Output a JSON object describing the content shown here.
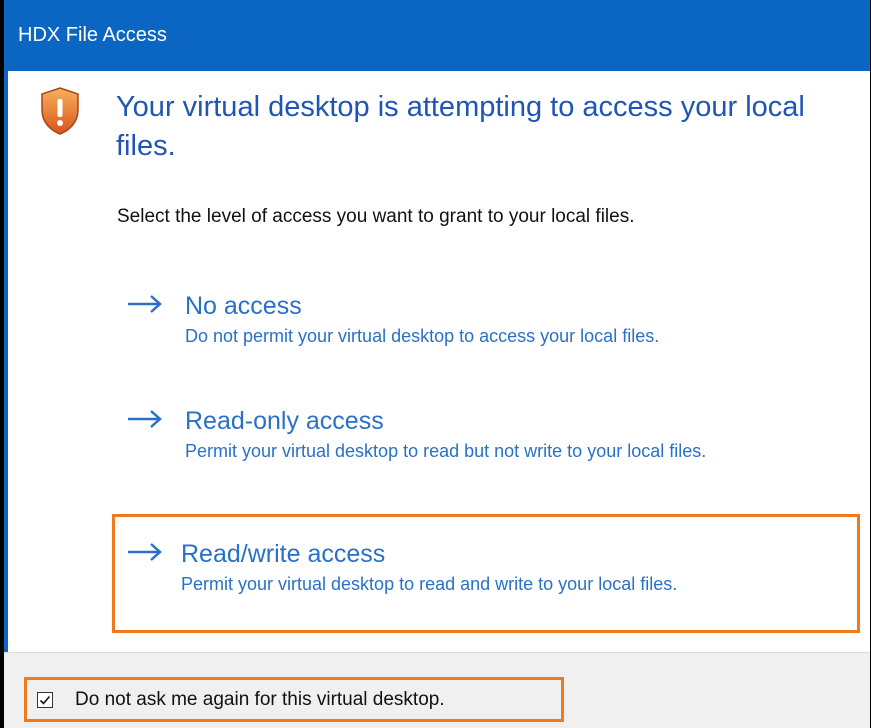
{
  "window": {
    "title": "HDX File Access"
  },
  "prompt": {
    "heading": "Your virtual desktop is attempting to access your local files.",
    "subtitle": "Select the level of access you want to grant to your local files."
  },
  "options": [
    {
      "title": "No access",
      "description": "Do not permit your virtual desktop to access your local files."
    },
    {
      "title": "Read-only access",
      "description": "Permit your virtual desktop to read but not write to your local files."
    },
    {
      "title": "Read/write access",
      "description": "Permit your virtual desktop to read and write to your local files."
    }
  ],
  "footer": {
    "dont_ask_label": "Do not ask me again for this virtual desktop.",
    "dont_ask_checked": true
  },
  "colors": {
    "titlebar": "#0a66c2",
    "link": "#2a70c9",
    "highlight": "#f07a1a"
  },
  "icons": {
    "shield": "warning-shield-icon",
    "arrow": "right-arrow-icon",
    "check": "checkmark-icon"
  }
}
